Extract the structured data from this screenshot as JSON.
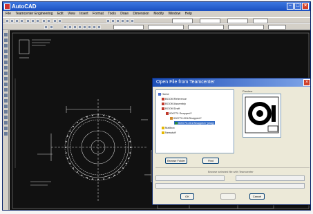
{
  "app": {
    "title": "AutoCAD"
  },
  "menus": [
    "File",
    "Teamcenter Engineering",
    "Edit",
    "View",
    "Insert",
    "Format",
    "Tools",
    "Draw",
    "Dimension",
    "Modify",
    "Window",
    "Help"
  ],
  "dialog": {
    "title": "Open File from Teamcenter",
    "preview_label": "Preview",
    "tree": [
      {
        "label": "Home"
      },
      {
        "label": "BOOK/Reference"
      },
      {
        "label": "BOOK/Assembly"
      },
      {
        "label": "BOOK/Draft"
      },
      {
        "label": "000770 Snapped?"
      },
      {
        "label": "000770-001/Snapped?"
      },
      {
        "label": "000770-001/Snapped? (dwg)"
      },
      {
        "label": "Mailbox"
      },
      {
        "label": "Newstuff"
      }
    ],
    "buttons": {
      "browse": "Browse Folder",
      "find": "Find",
      "ok": "OK",
      "cancel": "Cancel"
    },
    "note": "Browse selected file with Teamcenter"
  },
  "colors": {
    "titlebar": "#1b4fc0",
    "dialog_title": "#1c4fb8",
    "canvas": "#111111",
    "selection": "#316ac5"
  }
}
